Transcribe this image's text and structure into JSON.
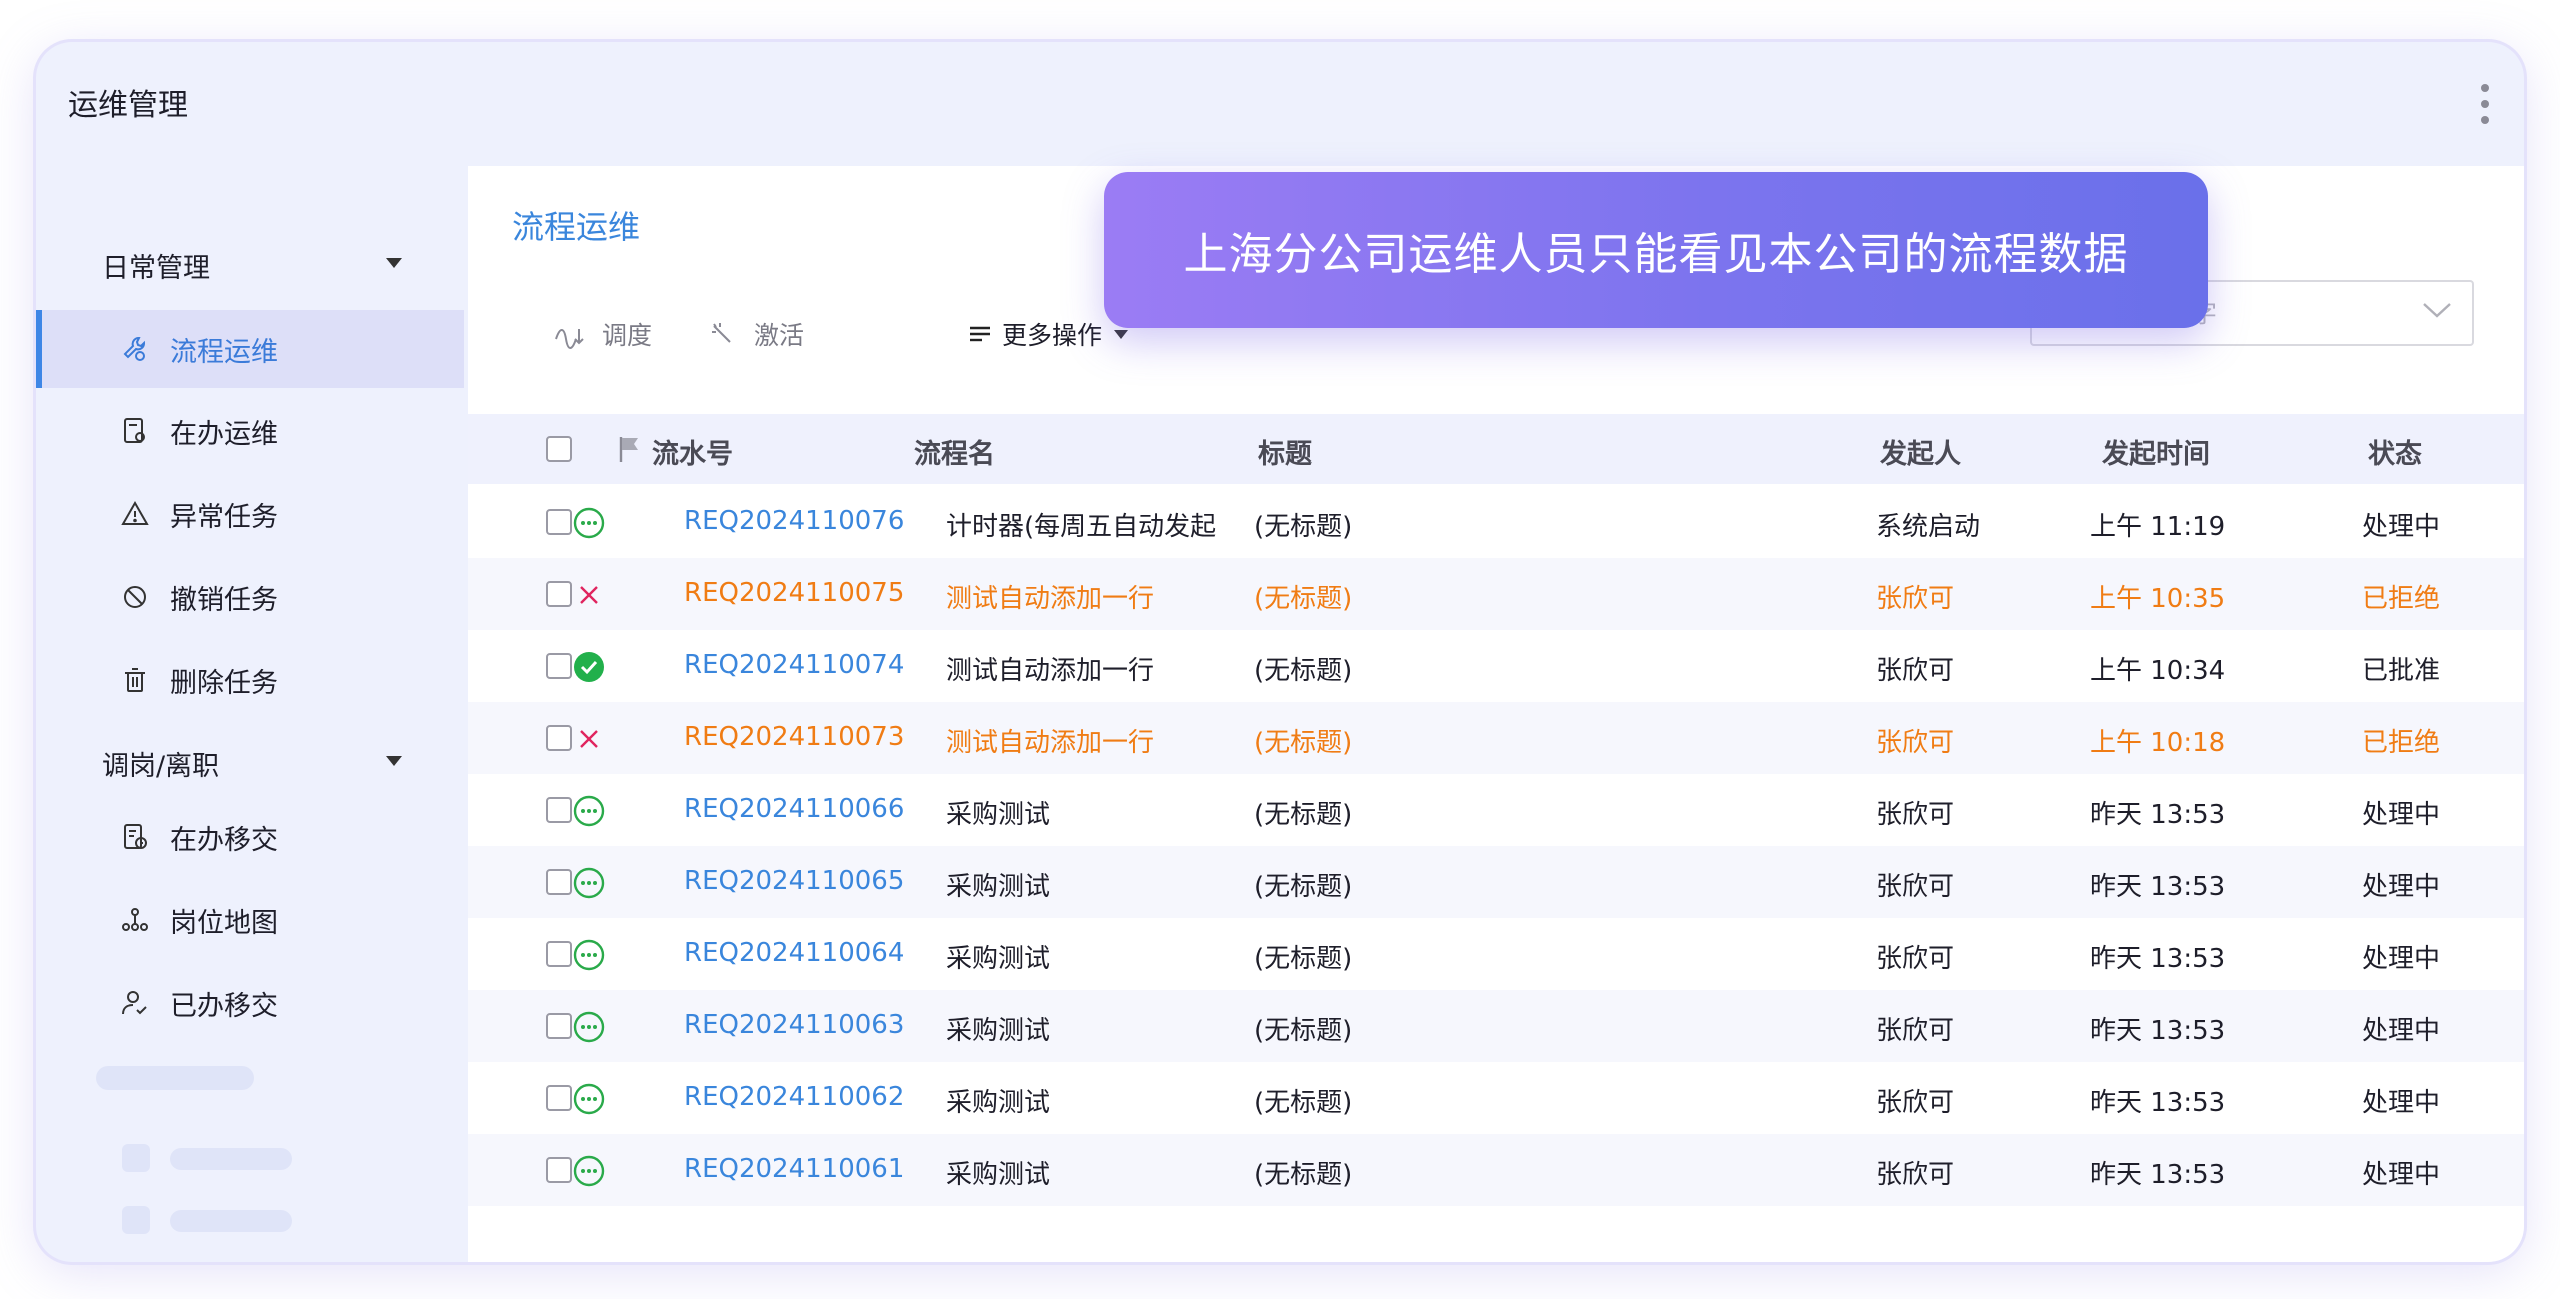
{
  "app": {
    "title": "运维管理"
  },
  "sidebar": {
    "groups": [
      {
        "label": "日常管理",
        "items": [
          {
            "label": "流程运维",
            "icon": "wrench-gear-icon",
            "active": true
          },
          {
            "label": "在办运维",
            "icon": "doc-gear-icon"
          },
          {
            "label": "异常任务",
            "icon": "warning-icon"
          },
          {
            "label": "撤销任务",
            "icon": "ban-icon"
          },
          {
            "label": "删除任务",
            "icon": "trash-icon"
          }
        ]
      },
      {
        "label": "调岗/离职",
        "items": [
          {
            "label": "在办移交",
            "icon": "doc-clock-icon"
          },
          {
            "label": "岗位地图",
            "icon": "org-chart-icon"
          },
          {
            "label": "已办移交",
            "icon": "user-check-icon"
          }
        ]
      }
    ]
  },
  "main": {
    "title": "流程运维",
    "toolbar": {
      "dispatch": "调度",
      "activate": "激活",
      "more": "更多操作"
    },
    "search": {
      "placeholder": "搜索关键字"
    }
  },
  "table": {
    "columns": {
      "serial": "流水号",
      "process": "流程名",
      "title": "标题",
      "initiator": "发起人",
      "time": "发起时间",
      "status": "状态"
    },
    "rows": [
      {
        "status_icon": "pending",
        "serial": "REQ2024110076",
        "process": "计时器(每周五自动发起",
        "title": "(无标题)",
        "initiator": "系统启动",
        "time": "上午 11:19",
        "status": "处理中"
      },
      {
        "status_icon": "rejected",
        "serial": "REQ2024110075",
        "process": "测试自动添加一行",
        "title": "(无标题)",
        "initiator": "张欣可",
        "time": "上午 10:35",
        "status": "已拒绝"
      },
      {
        "status_icon": "approved",
        "serial": "REQ2024110074",
        "process": "测试自动添加一行",
        "title": "(无标题)",
        "initiator": "张欣可",
        "time": "上午 10:34",
        "status": "已批准"
      },
      {
        "status_icon": "rejected",
        "serial": "REQ2024110073",
        "process": "测试自动添加一行",
        "title": "(无标题)",
        "initiator": "张欣可",
        "time": "上午 10:18",
        "status": "已拒绝"
      },
      {
        "status_icon": "pending",
        "serial": "REQ2024110066",
        "process": "采购测试",
        "title": "(无标题)",
        "initiator": "张欣可",
        "time": "昨天 13:53",
        "status": "处理中"
      },
      {
        "status_icon": "pending",
        "serial": "REQ2024110065",
        "process": "采购测试",
        "title": "(无标题)",
        "initiator": "张欣可",
        "time": "昨天 13:53",
        "status": "处理中"
      },
      {
        "status_icon": "pending",
        "serial": "REQ2024110064",
        "process": "采购测试",
        "title": "(无标题)",
        "initiator": "张欣可",
        "time": "昨天 13:53",
        "status": "处理中"
      },
      {
        "status_icon": "pending",
        "serial": "REQ2024110063",
        "process": "采购测试",
        "title": "(无标题)",
        "initiator": "张欣可",
        "time": "昨天 13:53",
        "status": "处理中"
      },
      {
        "status_icon": "pending",
        "serial": "REQ2024110062",
        "process": "采购测试",
        "title": "(无标题)",
        "initiator": "张欣可",
        "time": "昨天 13:53",
        "status": "处理中"
      },
      {
        "status_icon": "pending",
        "serial": "REQ2024110061",
        "process": "采购测试",
        "title": "(无标题)",
        "initiator": "张欣可",
        "time": "昨天 13:53",
        "status": "处理中"
      }
    ]
  },
  "toast": {
    "message": "上海分公司运维人员只能看见本公司的流程数据"
  },
  "colors": {
    "accent": "#3a86dc",
    "rejected": "#f07c14",
    "approved": "#22b04b",
    "pending": "#2aaa4a",
    "reject_x": "#e0245e"
  }
}
